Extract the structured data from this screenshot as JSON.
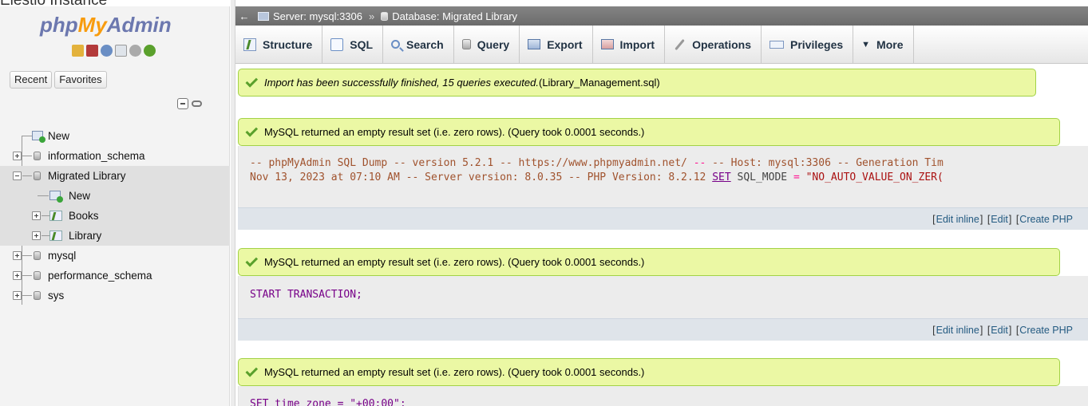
{
  "window_title": "Elestio Instance",
  "logo": {
    "part1": "php",
    "part2": "My",
    "part3": "Admin"
  },
  "nav_tabs": {
    "recent": "Recent",
    "favorites": "Favorites"
  },
  "tree": {
    "new": "New",
    "information_schema": "information_schema",
    "migrated_library": "Migrated Library",
    "ml_new": "New",
    "books": "Books",
    "library": "Library",
    "mysql": "mysql",
    "performance_schema": "performance_schema",
    "sys": "sys"
  },
  "breadcrumb": {
    "back": "←",
    "server": "Server: mysql:3306",
    "sep": "»",
    "database": "Database: Migrated Library"
  },
  "top_menu": {
    "structure": "Structure",
    "sql": "SQL",
    "search": "Search",
    "query": "Query",
    "export": "Export",
    "import": "Import",
    "operations": "Operations",
    "privileges": "Privileges",
    "more": "More"
  },
  "messages": {
    "import_success": "Import has been successfully finished, 15 queries executed.",
    "import_file": " (Library_Management.sql)",
    "empty_result": "MySQL returned an empty result set (i.e. zero rows). (Query took 0.0001 seconds.)"
  },
  "sql": {
    "dump_line1_a": "-- phpMyAdmin SQL Dump -- version 5.2.1 -- https://www.phpmyadmin.net/ ",
    "dump_line1_b": "--",
    "dump_line1_c": " -- Host: mysql:3306 -- Generation Tim",
    "dump_line2_a": "Nov 13, 2023 at 07:10 AM -- Server version: 8.0.35 -- PHP Version: 8.2.12 ",
    "dump_line2_kw": "SET",
    "dump_line2_b": " SQL_MODE ",
    "dump_line2_eq": "=",
    "dump_line2_str": " \"NO_AUTO_VALUE_ON_ZER(",
    "start_transaction": "START TRANSACTION;",
    "time_zone_partial": "SET time_zone = \"+00:00\";"
  },
  "actions": {
    "open": "[",
    "close": "]",
    "edit_inline": "Edit inline",
    "edit": "Edit",
    "create_php": "Create PHP"
  }
}
